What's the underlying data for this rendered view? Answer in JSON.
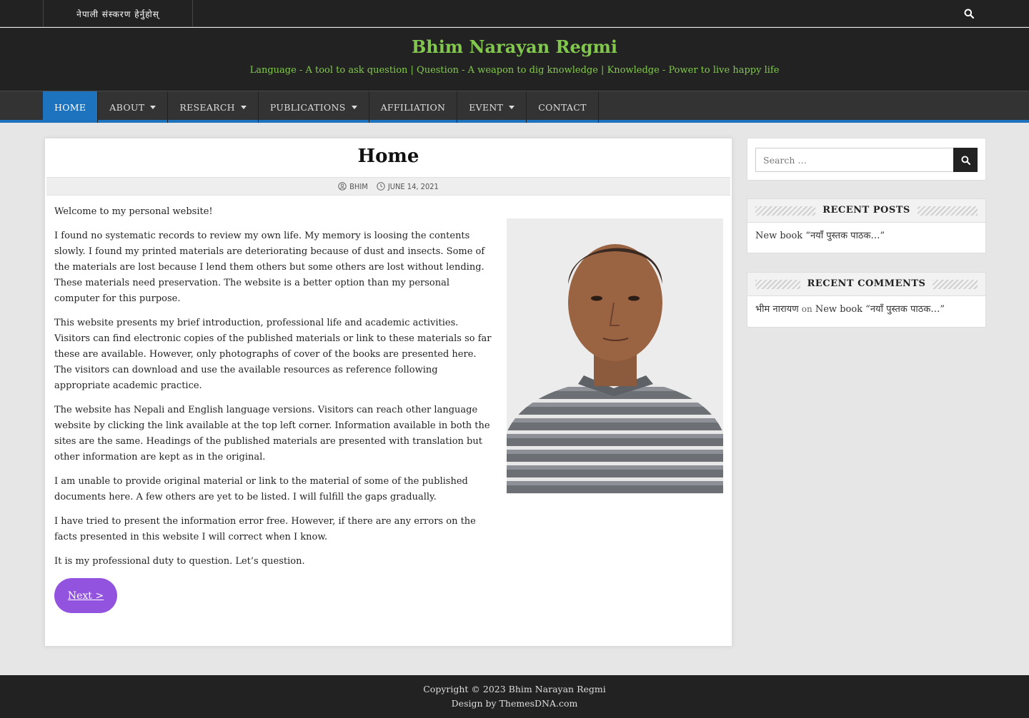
{
  "topbar": {
    "language_link": "नेपाली संस्करण हेर्नुहोस्"
  },
  "site": {
    "title": "Bhim Narayan Regmi",
    "description": "Language - A tool to ask question | Question - A weapon to dig knowledge | Knowledge - Power to live happy life"
  },
  "nav": {
    "items": [
      {
        "label": "Home",
        "active": true
      },
      {
        "label": "About"
      },
      {
        "label": "Research"
      },
      {
        "label": "Publications"
      },
      {
        "label": "Affiliation"
      },
      {
        "label": "Event"
      },
      {
        "label": "Contact"
      }
    ]
  },
  "post": {
    "title": "Home",
    "author": "BHIM",
    "date": "JUNE 14, 2021",
    "paragraphs": [
      "Welcome to my personal website!",
      "I found no systematic records to review my own life. My memory is loosing the contents slowly. I found my printed materials are deteriorating because of dust and insects. Some of the materials are lost because I lend them others but some others are lost without lending. These materials need preservation. The website is a better option than my personal computer for this purpose.",
      "This website presents my brief introduction, professional life and academic activities. Visitors can find electronic copies of the published materials or link to these materials so far these are available. However, only photographs of cover of the books are presented here. The visitors can download and use the available resources as reference following appropriate academic practice.",
      "The website has Nepali and English language versions. Visitors can reach other language website by clicking the link available at the top left corner. Information available in both the sites are the same. Headings of the published materials are presented with translation but other information are kept as in the original.",
      "I am unable to provide original material or link to the material of some of the published documents here. A few others are yet to be listed. I will fulfill the gaps gradually.",
      "I have tried to present the information error free. However, if there are any errors on the facts presented in this website I will correct when I know.",
      "It is my professional duty to question. Let’s question."
    ],
    "next_label": "Next >"
  },
  "sidebar": {
    "search_placeholder": "Search …",
    "recent_posts_title": "Recent Posts",
    "recent_post": "New book “नयाँ पुस्तक पाठक…”",
    "recent_comments_title": "Recent Comments",
    "comment_author": "भीम नारायण",
    "comment_on": "on",
    "comment_post": "New book “नयाँ पुस्तक पाठक…”"
  },
  "footer": {
    "copyright": "Copyright © 2023 Bhim Narayan Regmi",
    "design": "Design by ThemesDNA.com"
  }
}
